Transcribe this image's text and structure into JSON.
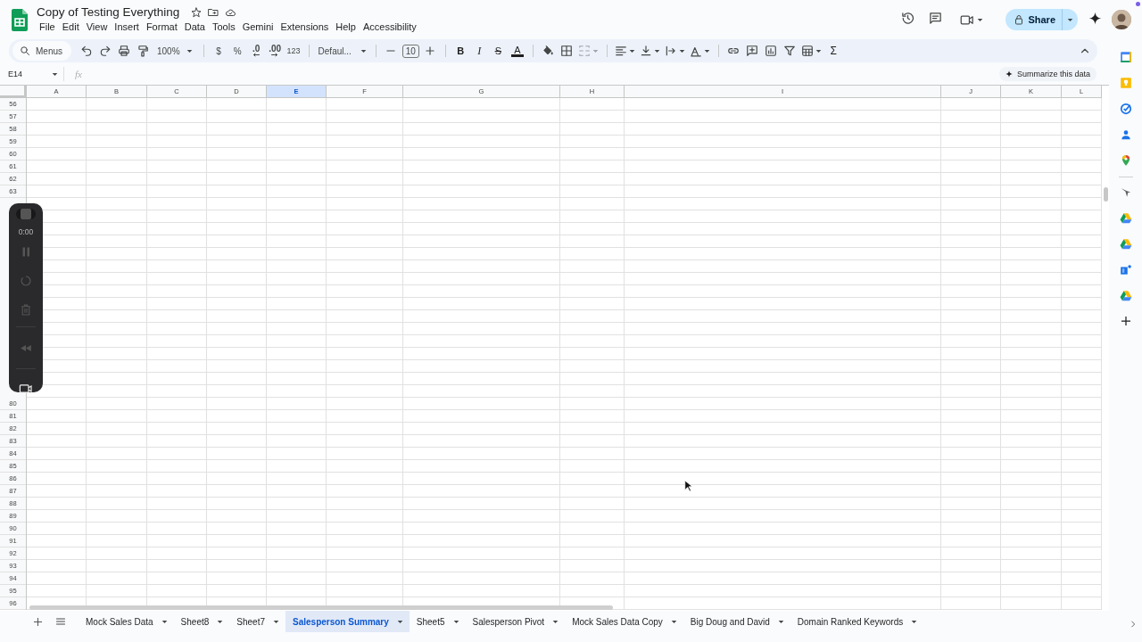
{
  "document": {
    "title": "Copy of Testing Everything"
  },
  "menu": [
    "File",
    "Edit",
    "View",
    "Insert",
    "Format",
    "Data",
    "Tools",
    "Gemini",
    "Extensions",
    "Help",
    "Accessibility"
  ],
  "share_button": {
    "label": "Share"
  },
  "toolbar": {
    "menus_search": {
      "placeholder": "Menus"
    },
    "zoom": "100%",
    "currency": "$",
    "percent": "%",
    "decrease_decimals": ".0",
    "increase_decimals": ".00",
    "number_format": "123",
    "font": "Defaul...",
    "font_size": "10",
    "bold": "B",
    "italic": "I",
    "strikethrough": "S",
    "text_color": "A",
    "functions": "Σ"
  },
  "formula_bar": {
    "cell_reference": "E14",
    "function_label": "fx",
    "summarize_chip": "Summarize this data"
  },
  "columns": [
    {
      "label": "A",
      "selected": false
    },
    {
      "label": "B",
      "selected": false
    },
    {
      "label": "C",
      "selected": false
    },
    {
      "label": "D",
      "selected": false
    },
    {
      "label": "E",
      "selected": true
    },
    {
      "label": "F",
      "selected": false
    },
    {
      "label": "G",
      "selected": false
    },
    {
      "label": "H",
      "selected": false
    },
    {
      "label": "I",
      "selected": false
    },
    {
      "label": "J",
      "selected": false
    },
    {
      "label": "K",
      "selected": false
    },
    {
      "label": "L",
      "selected": false
    }
  ],
  "rows": {
    "above_recorder": [
      "56",
      "57",
      "58",
      "59",
      "60",
      "61",
      "62",
      "63"
    ],
    "below_recorder": [
      "80",
      "81",
      "82",
      "83",
      "84",
      "85",
      "86",
      "87",
      "88",
      "89",
      "90",
      "91",
      "92",
      "93",
      "94",
      "95",
      "96"
    ]
  },
  "recorder": {
    "timer": "0:00"
  },
  "sheet_tabs": [
    {
      "label": "Mock Sales Data",
      "selected": false
    },
    {
      "label": "Sheet8",
      "selected": false
    },
    {
      "label": "Sheet7",
      "selected": false
    },
    {
      "label": "Salesperson Summary",
      "selected": true
    },
    {
      "label": "Sheet5",
      "selected": false
    },
    {
      "label": "Salesperson Pivot",
      "selected": false
    },
    {
      "label": "Mock Sales Data Copy",
      "selected": false
    },
    {
      "label": "Big Doug and David",
      "selected": false
    },
    {
      "label": "Domain Ranked Keywords",
      "selected": false
    }
  ]
}
